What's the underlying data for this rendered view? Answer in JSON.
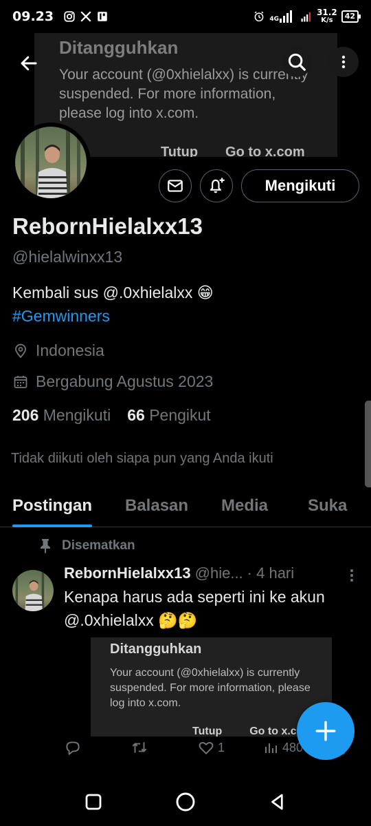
{
  "status_bar": {
    "time": "09.23",
    "network_type": "4G",
    "net_speed_value": "31.2",
    "net_speed_unit": "K/s",
    "battery": "42"
  },
  "header": {
    "back_icon": "arrow-left-icon",
    "search_icon": "search-icon",
    "more_icon": "more-vertical-icon"
  },
  "suspend_banner": {
    "title": "Ditangguhkan",
    "body": "Your account (@0xhielalxx) is currently suspended. For more information, please log into x.com.",
    "close_label": "Tutup",
    "goto_label": "Go to x.com"
  },
  "profile": {
    "display_name": "RebornHielalxx13",
    "handle": "@hielalwinxx13",
    "bio_line1": "Kembali sus @.0xhielalxx 😁",
    "bio_hashtag": "#Gemwinners",
    "location": "Indonesia",
    "joined": "Bergabung Agustus 2023",
    "following_count": "206",
    "following_label": "Mengikuti",
    "followers_count": "66",
    "followers_label": "Pengikut",
    "followed_note": "Tidak diikuti oleh siapa pun yang Anda ikuti",
    "follow_button": "Mengikuti"
  },
  "tabs": [
    {
      "label": "Postingan",
      "active": true
    },
    {
      "label": "Balasan",
      "active": false
    },
    {
      "label": "Media",
      "active": false
    },
    {
      "label": "Suka",
      "active": false
    }
  ],
  "post": {
    "pinned_label": "Disematkan",
    "author": "RebornHielalxx13",
    "handle": "@hie...",
    "time": "· 4 hari",
    "text": "Kenapa harus ada seperti ini ke akun @.0xhielalxx 🤔🤔",
    "embed": {
      "title": "Ditangguhkan",
      "body": "Your account (@0xhielalxx) is currently suspended. For more information, please log into x.com.",
      "close_label": "Tutup",
      "goto_label": "Go to x.com"
    },
    "likes": "1",
    "views": "480"
  },
  "colors": {
    "accent": "#1d9bf0",
    "muted": "#71767b",
    "text": "#e7e9ea",
    "background": "#000000"
  }
}
